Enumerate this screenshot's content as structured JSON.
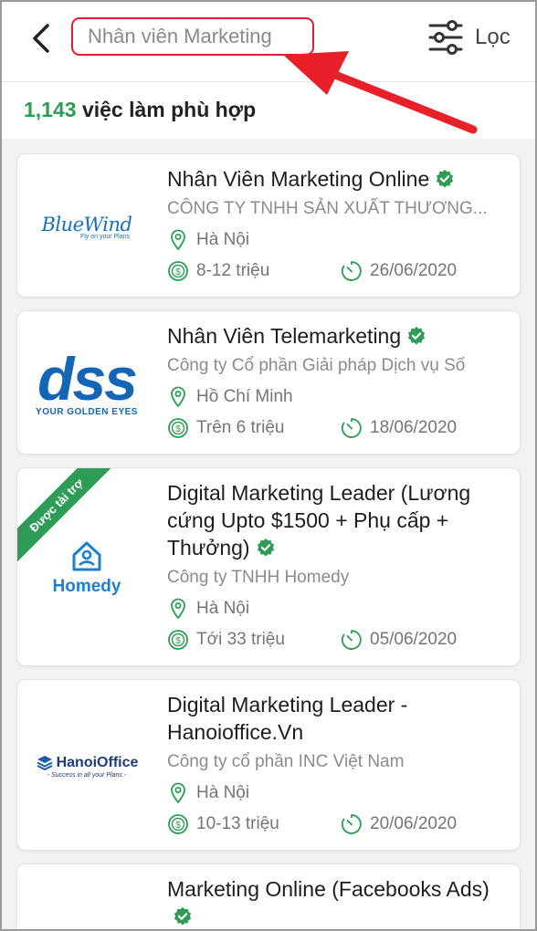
{
  "header": {
    "search_value": "Nhân viên Marketing",
    "filter_label": "Lọc"
  },
  "results": {
    "count": "1,143",
    "label": " việc làm phù hợp"
  },
  "colors": {
    "accent": "#2e9c57",
    "highlight": "#d92231"
  },
  "jobs": [
    {
      "title": "Nhân Viên Marketing Online",
      "company": "CÔNG TY TNHH SẢN XUẤT THƯƠNG...",
      "location": "Hà Nội",
      "salary": "8-12 triệu",
      "date": "26/06/2020",
      "logo_name": "BlueWind",
      "logo_tagline": "Fly on your Plans"
    },
    {
      "title": "Nhân Viên Telemarketing",
      "company": "Công ty Cổ phần Giải pháp Dịch vụ Số",
      "location": "Hồ Chí Minh",
      "salary": "Trên 6 triệu",
      "date": "18/06/2020",
      "logo_name": "dss",
      "logo_tagline": "YOUR GOLDEN EYES"
    },
    {
      "title": "Digital Marketing Leader (Lương cứng Upto $1500 + Phụ cấp + Thưởng)",
      "company": "Công ty TNHH Homedy",
      "location": "Hà Nội",
      "salary": "Tới 33 triệu",
      "date": "05/06/2020",
      "logo_name": "Homedy",
      "ribbon": "Được tài trợ"
    },
    {
      "title": "Digital Marketing Leader - Hanoioffice.Vn",
      "company": "Công ty cổ phần INC Việt Nam",
      "location": "Hà Nội",
      "salary": "10-13 triệu",
      "date": "20/06/2020",
      "logo_name": "HanoiOffice",
      "logo_tagline": "- Success in all your Plans -"
    },
    {
      "title": "Marketing Online (Facebooks Ads)"
    }
  ]
}
